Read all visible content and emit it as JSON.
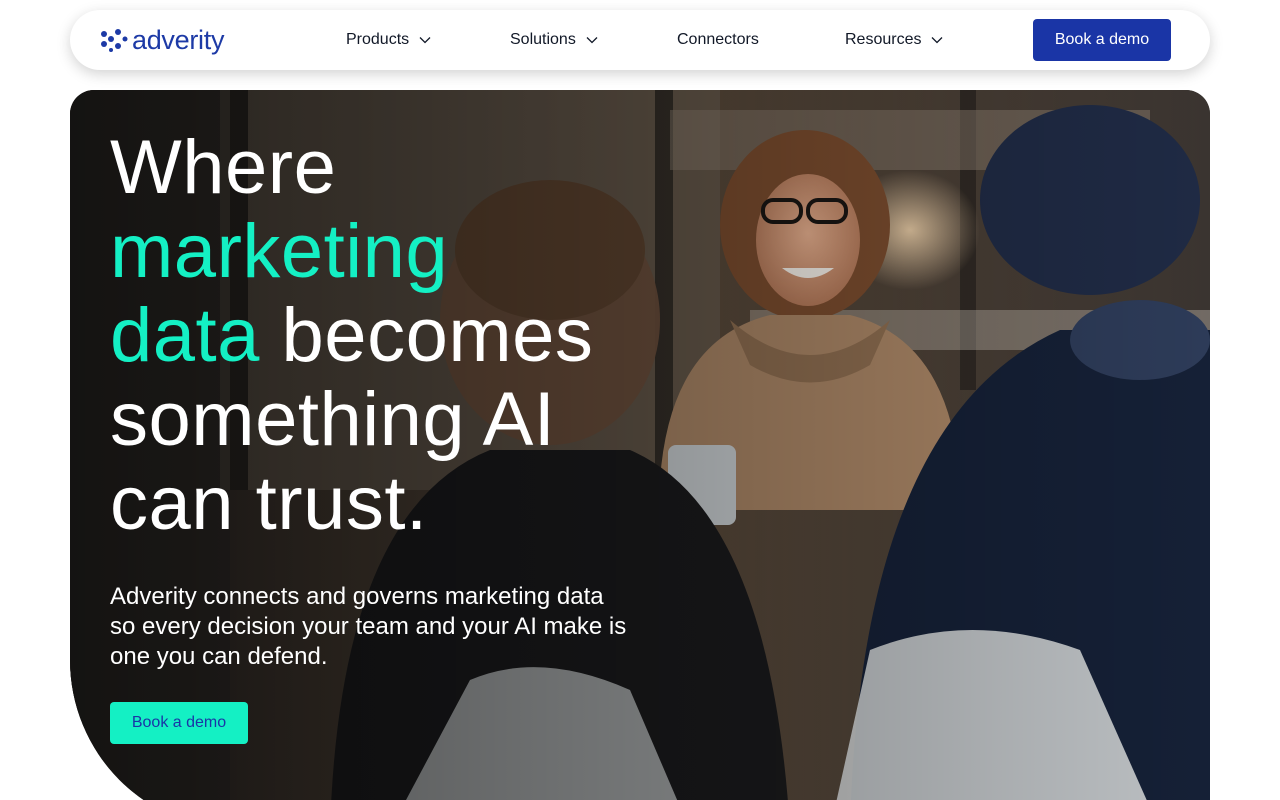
{
  "brand": {
    "name": "adverity",
    "logo_icon": "adverity-dots-icon",
    "color": "#1d3aa6"
  },
  "nav": {
    "items": [
      {
        "label": "Products",
        "icon": "chevron-down-icon"
      },
      {
        "label": "Solutions",
        "icon": "chevron-down-icon"
      },
      {
        "label": "Connectors"
      },
      {
        "label": "Resources",
        "icon": "chevron-down-icon"
      }
    ],
    "cta_label": "Book a demo",
    "cta_color": "#1a35a6"
  },
  "hero": {
    "headline": {
      "line1": "Where",
      "line2_accent": "marketing",
      "line3_accent": "data",
      "line3_rest": " becomes",
      "line4": "something AI",
      "line5": "can trust."
    },
    "accent_color": "#14f0c4",
    "subheadline": "Adverity connects and governs marketing data so every decision your team and your AI make is one you can defend.",
    "cta_label": "Book a demo",
    "image": "photo-team-meeting-office"
  }
}
